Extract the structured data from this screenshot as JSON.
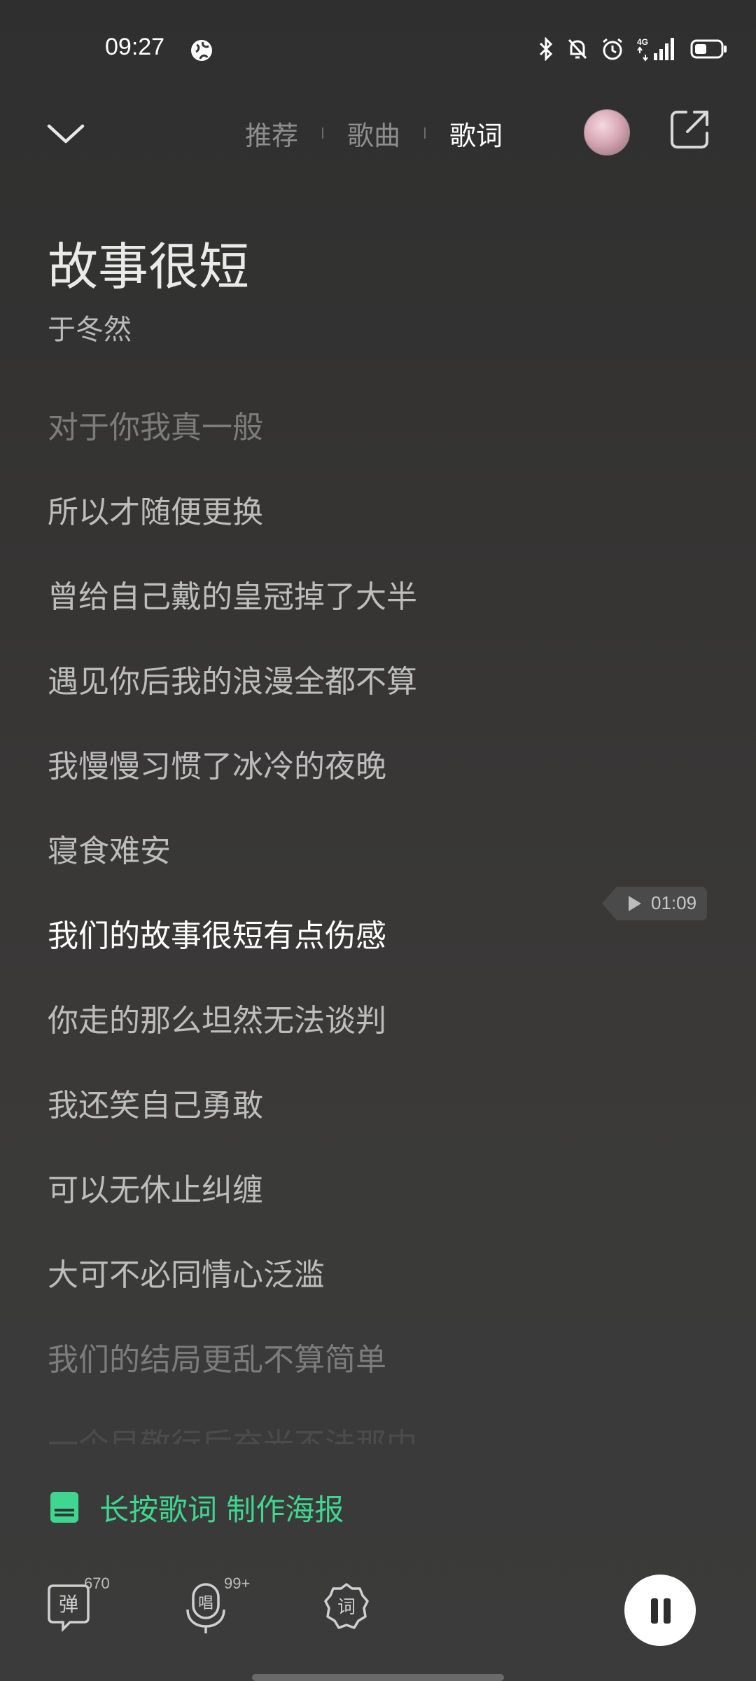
{
  "status_bar": {
    "time": "09:27",
    "network": "4G",
    "icons": [
      "globe-icon",
      "bluetooth-icon",
      "mute-bell-icon",
      "alarm-icon",
      "signal-icon",
      "battery-icon"
    ]
  },
  "nav": {
    "tabs": [
      {
        "label": "推荐",
        "active": false
      },
      {
        "label": "歌曲",
        "active": false
      },
      {
        "label": "歌词",
        "active": true
      }
    ],
    "icons": [
      "chevron-down-icon",
      "avatar",
      "share-icon"
    ]
  },
  "song": {
    "title": "故事很短",
    "artist": "于冬然"
  },
  "lyrics": [
    "对于你我真一般",
    "所以才随便更换",
    "曾给自己戴的皇冠掉了大半",
    "遇见你后我的浪漫全都不算",
    "我慢慢习惯了冰冷的夜晚",
    "寝食难安",
    "我们的故事很短有点伤感",
    "你走的那么坦然无法谈判",
    "我还笑自己勇敢",
    "可以无休止纠缠",
    "大可不必同情心泛滥",
    "我们的结局更乱不算简单",
    "一个目敬行后充光不法那中"
  ],
  "current_lyric_index": 6,
  "seek_time": "01:09",
  "poster": {
    "label": "长按歌词 制作海报",
    "accent_color": "#3fd68f"
  },
  "controls": {
    "danmaku": {
      "label": "弹",
      "count": "670"
    },
    "sing": {
      "label": "唱",
      "count": "99+"
    },
    "lyrics_btn": {
      "label": "词"
    }
  }
}
